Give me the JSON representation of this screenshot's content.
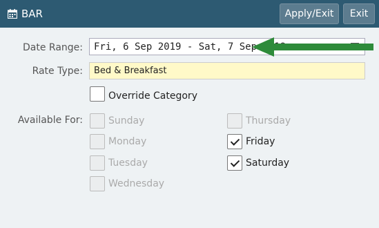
{
  "header": {
    "title": "BAR",
    "apply_label": "Apply/Exit",
    "exit_label": "Exit",
    "icon": "calendar-icon"
  },
  "form": {
    "date_range_label": "Date Range:",
    "date_range_value": "Fri, 6 Sep 2019 - Sat, 7 Sep 2019",
    "rate_type_label": "Rate Type:",
    "rate_type_value": "Bed & Breakfast",
    "override_label": "Override Category",
    "available_label": "Available For:"
  },
  "days": {
    "sunday": {
      "label": "Sunday",
      "checked": false
    },
    "monday": {
      "label": "Monday",
      "checked": false
    },
    "tuesday": {
      "label": "Tuesday",
      "checked": false
    },
    "wednesday": {
      "label": "Wednesday",
      "checked": false
    },
    "thursday": {
      "label": "Thursday",
      "checked": false
    },
    "friday": {
      "label": "Friday",
      "checked": true
    },
    "saturday": {
      "label": "Saturday",
      "checked": true
    }
  },
  "colors": {
    "header_bg": "#2d5a72",
    "rate_input_bg": "#fff9c8",
    "arrow": "#2e8b3a"
  }
}
